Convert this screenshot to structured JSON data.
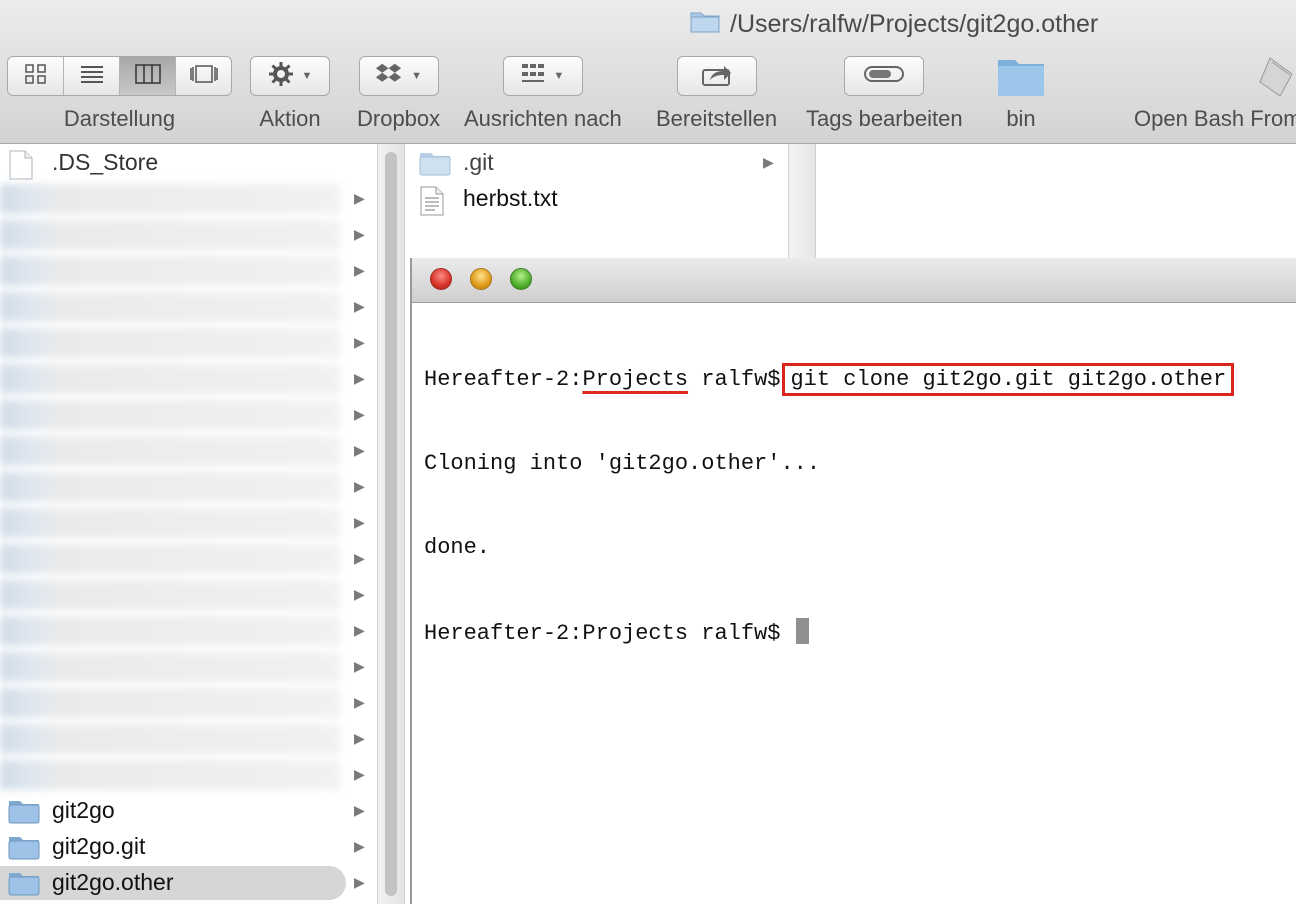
{
  "window": {
    "path": "/Users/ralfw/Projects/git2go.other"
  },
  "toolbar": {
    "view_label": "Darstellung",
    "action_label": "Aktion",
    "dropbox_label": "Dropbox",
    "arrange_label": "Ausrichten nach",
    "share_label": "Bereitstellen",
    "tags_label": "Tags bearbeiten",
    "bin_label": "bin",
    "openbash_label": "Open Bash From"
  },
  "column1": {
    "items": [
      {
        "name": ".DS_Store",
        "type": "file",
        "has_children": false
      },
      {
        "name": "git2go",
        "type": "folder",
        "has_children": true
      },
      {
        "name": "git2go.git",
        "type": "folder",
        "has_children": true
      },
      {
        "name": "git2go.other",
        "type": "folder",
        "has_children": true,
        "selected": true
      }
    ],
    "blurred_rows": 17
  },
  "column2": {
    "items": [
      {
        "name": ".git",
        "type": "folder",
        "has_children": true
      },
      {
        "name": "herbst.txt",
        "type": "file",
        "has_children": false
      }
    ]
  },
  "terminal": {
    "prompt_host": "Hereafter-2:",
    "prompt_dir": "Projects",
    "prompt_user": " ralfw$",
    "command": "git clone git2go.git git2go.other",
    "output": [
      "Cloning into 'git2go.other'...",
      "done."
    ],
    "prompt2": "Hereafter-2:Projects ralfw$ "
  },
  "colors": {
    "annotation_red": "#d9261c",
    "folder_blue": "#8fb6d9"
  }
}
